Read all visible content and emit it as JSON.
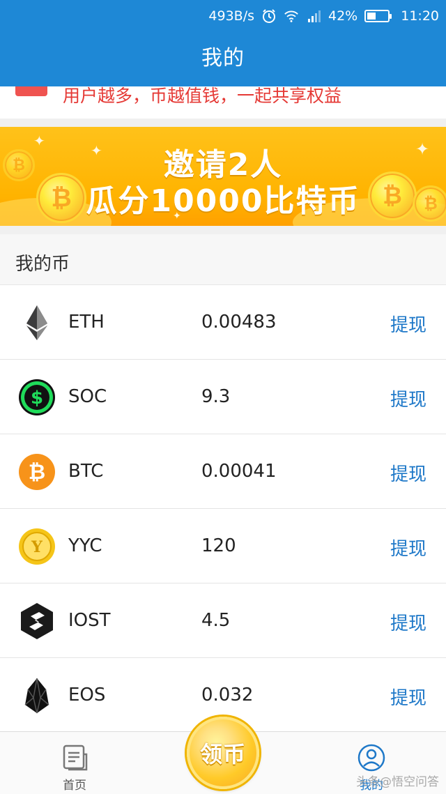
{
  "status_bar": {
    "net_speed": "493B/s",
    "battery_percent": "42%",
    "battery_level": 0.42,
    "time": "11:20",
    "icons": [
      "alarm-icon",
      "wifi-icon",
      "signal-icon",
      "battery-icon"
    ]
  },
  "header": {
    "title": "我的"
  },
  "promo": {
    "text": "用户越多，币越值钱，一起共享权益"
  },
  "banner": {
    "line1": "邀请2人",
    "line2": "瓜分10000比特币"
  },
  "section": {
    "title": "我的币"
  },
  "coins": [
    {
      "symbol": "ETH",
      "amount": "0.00483",
      "action": "提现",
      "icon": "eth-icon"
    },
    {
      "symbol": "SOC",
      "amount": "9.3",
      "action": "提现",
      "icon": "soc-icon"
    },
    {
      "symbol": "BTC",
      "amount": "0.00041",
      "action": "提现",
      "icon": "btc-icon"
    },
    {
      "symbol": "YYC",
      "amount": "120",
      "action": "提现",
      "icon": "yyc-icon"
    },
    {
      "symbol": "IOST",
      "amount": "4.5",
      "action": "提现",
      "icon": "iost-icon"
    },
    {
      "symbol": "EOS",
      "amount": "0.032",
      "action": "提现",
      "icon": "eos-icon"
    }
  ],
  "bottom_nav": {
    "home_label": "首页",
    "center_label": "领币",
    "mine_label": "我的"
  },
  "watermark": "头条@悟空问答",
  "colors": {
    "primary": "#1e88d6",
    "link": "#1e78c8",
    "promo_red": "#e53935",
    "banner": "#ffb300"
  }
}
